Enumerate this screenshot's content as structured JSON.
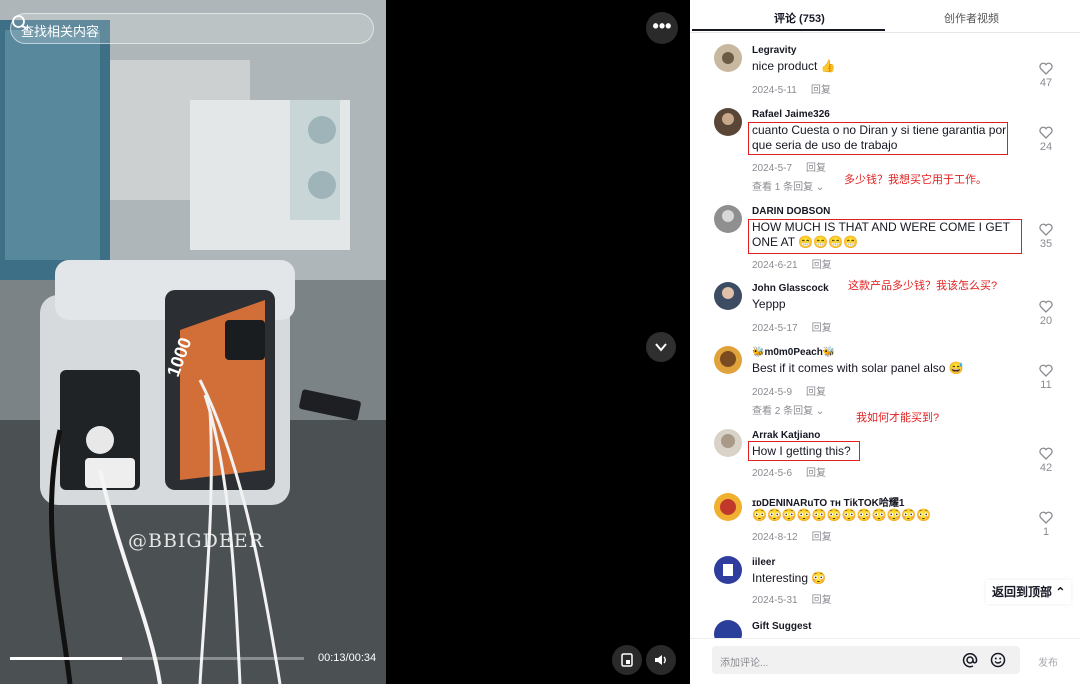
{
  "video": {
    "search_placeholder": "查找相关内容",
    "watermark": "@BBIGDEER",
    "time": "00:13/00:34",
    "progress": 0.38,
    "device_label": "1000"
  },
  "tabs": [
    {
      "label": "评论 (753)",
      "active": true
    },
    {
      "label": "创作者视频",
      "active": false
    }
  ],
  "comments": [
    {
      "user": "Legravity",
      "text": "nice product 👍",
      "date": "2024-5-11",
      "reply": "回复",
      "likes": "47"
    },
    {
      "user": "Rafael Jaime326",
      "text": "cuanto Cuesta o no Diran y si tiene garantia por que seria de uso de trabajo",
      "date": "2024-5-7",
      "reply": "回复",
      "likes": "24",
      "more_replies": "查看 1 条回复"
    },
    {
      "user": "DARIN DOBSON",
      "text": "HOW MUCH IS THAT AND WERE COME I GET ONE AT 😁😁😁😁",
      "date": "2024-6-21",
      "reply": "回复",
      "likes": "35"
    },
    {
      "user": "John Glasscock",
      "text": "Yeppp",
      "date": "2024-5-17",
      "reply": "回复",
      "likes": "20"
    },
    {
      "user": "🐝m0m0Peach🐝",
      "text": "Best if it comes with solar panel also 😅",
      "date": "2024-5-9",
      "reply": "回复",
      "likes": "11",
      "more_replies": "查看 2 条回复"
    },
    {
      "user": "Arrak Katjiano",
      "text": "How I getting this?",
      "date": "2024-5-6",
      "reply": "回复",
      "likes": "42"
    },
    {
      "user": "ɪᴅDENINARuTO ᴛʜ TikTOK哈耀1",
      "text": "😳😳😳😳😳😳😳😳😳😳😳😳",
      "date": "2024-8-12",
      "reply": "回复",
      "likes": "1"
    },
    {
      "user": "iileer",
      "text": "Interesting 😳",
      "date": "2024-5-31",
      "reply": "回复",
      "likes": ""
    },
    {
      "user": "Gift Suggest",
      "text": "",
      "date": "",
      "reply": "",
      "likes": ""
    }
  ],
  "annotations": [
    "多少钱？我想买它用于工作。",
    "这款产品多少钱？我该怎么买?",
    "我如何才能买到?"
  ],
  "back_to_top": "返回到顶部",
  "composer": {
    "placeholder": "添加评论...",
    "post_label": "发布"
  },
  "colors": {
    "annotation": "#e02020",
    "text": "#161823",
    "muted": "#8a8b91"
  }
}
